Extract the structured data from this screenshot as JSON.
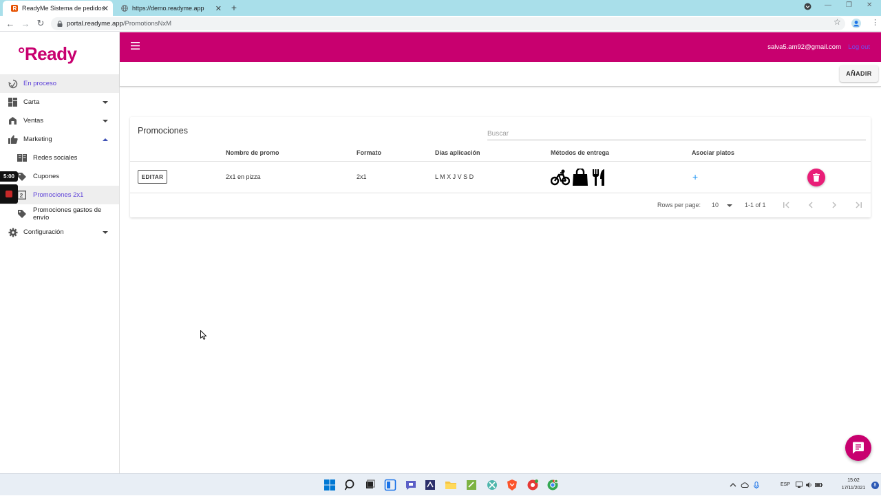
{
  "browser": {
    "tabs": [
      {
        "title": "ReadyMe Sistema de pedidos",
        "active": true
      },
      {
        "title": "https://demo.readyme.app",
        "active": false
      }
    ],
    "url_host": "portal.readyme.app",
    "url_path": "/PromotionsNxM"
  },
  "app": {
    "logo": "°Ready",
    "brand_color": "#c8006f",
    "user_email": "salva5.am92@gmail.com",
    "logout_label": "Log out"
  },
  "sidebar": {
    "items": [
      {
        "label": "En proceso",
        "icon": "sync-icon",
        "active": true
      },
      {
        "label": "Carta",
        "icon": "dashboard-icon",
        "expandable": true
      },
      {
        "label": "Ventas",
        "icon": "store-icon",
        "expandable": true
      },
      {
        "label": "Marketing",
        "icon": "thumb-up-icon",
        "expanded": true
      },
      {
        "label": "Redes sociales",
        "icon": "book-icon",
        "sub": true
      },
      {
        "label": "Cupones",
        "icon": "tag-icon",
        "sub": true
      },
      {
        "label": "Promociones 2x1",
        "icon": "counter-icon",
        "sub": true,
        "active": true
      },
      {
        "label": "Promociones gastos de envío",
        "icon": "tag-icon",
        "sub": true
      },
      {
        "label": "Configuración",
        "icon": "gear-icon",
        "expandable": true
      }
    ]
  },
  "overlay": {
    "timer": "5:00"
  },
  "toolbar": {
    "add_label": "AÑADIR"
  },
  "promotions": {
    "title": "Promociones",
    "search_placeholder": "Buscar",
    "columns": [
      "Nombre de promo",
      "Formato",
      "Días aplicación",
      "Métodos de entrega",
      "Asociar platos"
    ],
    "rows": [
      {
        "edit_label": "EDITAR",
        "name": "2x1 en pizza",
        "format": "2x1",
        "days": "L M X J V S D",
        "delivery_methods": [
          "bike-icon",
          "shopping-bag-icon",
          "utensils-icon"
        ],
        "associate": "+"
      }
    ],
    "pagination": {
      "rows_per_page_label": "Rows per page:",
      "rows_per_page": "10",
      "range": "1-1 of 1"
    }
  },
  "taskbar": {
    "language": "ESP",
    "time": "15:02",
    "date": "17/11/2021",
    "notifications": "8"
  }
}
